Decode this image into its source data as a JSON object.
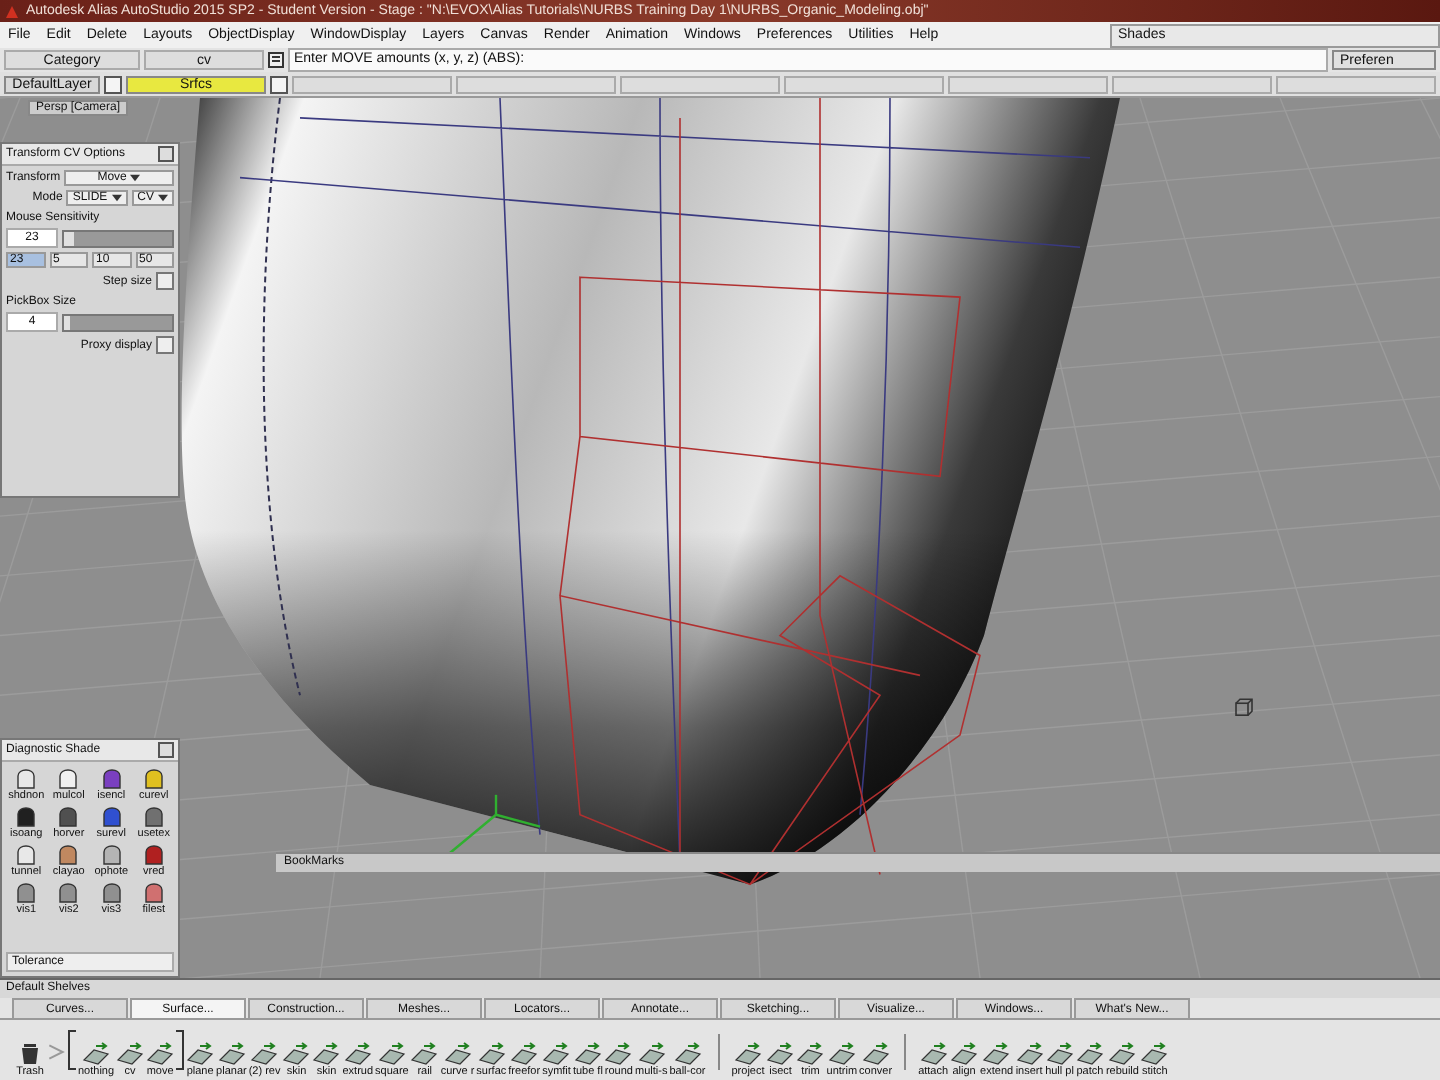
{
  "window": {
    "title": "Autodesk Alias AutoStudio 2015 SP2 - Student Version   - Stage : \"N:\\EVOX\\Alias Tutorials\\NURBS Training Day 1\\NURBS_Organic_Modeling.obj\""
  },
  "menu": [
    "File",
    "Edit",
    "Delete",
    "Layouts",
    "ObjectDisplay",
    "WindowDisplay",
    "Layers",
    "Canvas",
    "Render",
    "Animation",
    "Windows",
    "Preferences",
    "Utilities",
    "Help"
  ],
  "shades_field": "Shades",
  "category": "Category",
  "category_value": "cv",
  "prompt": "Enter MOVE amounts (x, y, z) (ABS):",
  "preferences_button": "Preferen",
  "layers": [
    {
      "name": "DefaultLayer",
      "selected": false,
      "checked": false
    },
    {
      "name": "Srfcs",
      "selected": true,
      "checked": false
    }
  ],
  "viewport": {
    "label": "Persp [Camera]",
    "bookmarks": "BookMarks"
  },
  "transform_panel": {
    "title": "Transform CV Options",
    "transform_label": "Transform",
    "transform_value": "Move",
    "mode_label": "Mode",
    "mode_value": "SLIDE",
    "mode_type": "CV",
    "sensitivity_label": "Mouse Sensitivity",
    "sensitivity_value": "23",
    "sensitivity_slider": {
      "level": 0.1
    },
    "presets": [
      {
        "label": "23",
        "selected": true
      },
      {
        "label": "5",
        "selected": false
      },
      {
        "label": "10",
        "selected": false
      },
      {
        "label": "50",
        "selected": false
      }
    ],
    "step_size": {
      "label": "Step size",
      "checked": false
    },
    "pickbox_label": "PickBox Size",
    "pickbox_value": "4",
    "pickbox_slider": {
      "level": 0.05
    },
    "proxy_display": {
      "label": "Proxy display",
      "checked": false
    }
  },
  "diagnostic_panel": {
    "title": "Diagnostic Shade",
    "tolerance": "Tolerance",
    "items": [
      {
        "label": "shdnon",
        "color": "#e8e8e8"
      },
      {
        "label": "mulcol",
        "color": "#f0f0f0"
      },
      {
        "label": "isencl",
        "color": "#7a3fc0"
      },
      {
        "label": "curevl",
        "color": "#e0c020"
      },
      {
        "label": "isoang",
        "color": "#202020"
      },
      {
        "label": "horver",
        "color": "#505050"
      },
      {
        "label": "surevl",
        "color": "#3050d0"
      },
      {
        "label": "usetex",
        "color": "#707070"
      },
      {
        "label": "tunnel",
        "color": "#e8e8e8"
      },
      {
        "label": "clayao",
        "color": "#c08860"
      },
      {
        "label": "ophote",
        "color": "#b4b4b4"
      },
      {
        "label": "vred",
        "color": "#b02020"
      },
      {
        "label": "vis1",
        "color": "#909090"
      },
      {
        "label": "vis2",
        "color": "#909090"
      },
      {
        "label": "vis3",
        "color": "#909090"
      },
      {
        "label": "filest",
        "color": "#d07070"
      }
    ]
  },
  "shelves": {
    "title": "Default Shelves",
    "tabs": [
      {
        "label": "Curves...",
        "selected": false
      },
      {
        "label": "Surface...",
        "selected": true
      },
      {
        "label": "Construction...",
        "selected": false
      },
      {
        "label": "Meshes...",
        "selected": false
      },
      {
        "label": "Locators...",
        "selected": false
      },
      {
        "label": "Annotate...",
        "selected": false
      },
      {
        "label": "Sketching...",
        "selected": false
      },
      {
        "label": "Visualize...",
        "selected": false
      },
      {
        "label": "Windows...",
        "selected": false
      },
      {
        "label": "What's New...",
        "selected": false
      }
    ],
    "tools": [
      {
        "kind": "trash",
        "label": "Trash"
      },
      {
        "kind": "arrow"
      },
      {
        "kind": "open"
      },
      {
        "kind": "tool",
        "label": "nothing"
      },
      {
        "kind": "tool",
        "label": "cv"
      },
      {
        "kind": "tool",
        "label": "move"
      },
      {
        "kind": "close"
      },
      {
        "kind": "tool",
        "label": "plane"
      },
      {
        "kind": "tool",
        "label": "planar"
      },
      {
        "kind": "tool",
        "label": "(2) rev"
      },
      {
        "kind": "tool",
        "label": "skin"
      },
      {
        "kind": "tool",
        "label": "skin"
      },
      {
        "kind": "tool",
        "label": "extrud"
      },
      {
        "kind": "tool",
        "label": "square"
      },
      {
        "kind": "tool",
        "label": "rail"
      },
      {
        "kind": "tool",
        "label": "curve r"
      },
      {
        "kind": "tool",
        "label": "surfac"
      },
      {
        "kind": "tool",
        "label": "freefor"
      },
      {
        "kind": "tool",
        "label": "symfit"
      },
      {
        "kind": "tool",
        "label": "tube fl"
      },
      {
        "kind": "tool",
        "label": "round"
      },
      {
        "kind": "tool",
        "label": "multi-s"
      },
      {
        "kind": "tool",
        "label": "ball-cor"
      },
      {
        "kind": "separator"
      },
      {
        "kind": "tool",
        "label": "project"
      },
      {
        "kind": "tool",
        "label": "isect"
      },
      {
        "kind": "tool",
        "label": "trim"
      },
      {
        "kind": "tool",
        "label": "untrim"
      },
      {
        "kind": "tool",
        "label": "conver"
      },
      {
        "kind": "separator"
      },
      {
        "kind": "tool",
        "label": "attach"
      },
      {
        "kind": "tool",
        "label": "align"
      },
      {
        "kind": "tool",
        "label": "extend"
      },
      {
        "kind": "tool",
        "label": "insert"
      },
      {
        "kind": "tool",
        "label": "hull pl"
      },
      {
        "kind": "tool",
        "label": "patch"
      },
      {
        "kind": "tool",
        "label": "rebuild"
      },
      {
        "kind": "tool",
        "label": "stitch"
      }
    ]
  }
}
